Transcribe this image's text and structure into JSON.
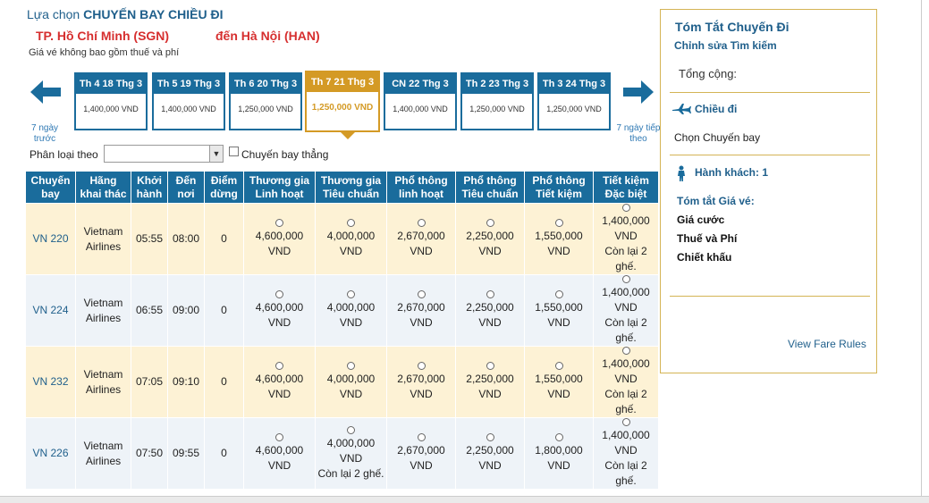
{
  "header": {
    "title_prefix": "Lựa chọn ",
    "title_bold": "CHUYẾN BAY CHIỀU ĐI",
    "from": "TP. Hồ Chí Minh (SGN)",
    "to": "đến Hà Nội (HAN)",
    "price_note": "Giá vé không bao gồm thuế và phí"
  },
  "nav": {
    "prev_text": "7 ngày trước",
    "next_text": "7 ngày tiếp theo"
  },
  "dates": [
    {
      "label": "Th 4 18 Thg 3",
      "price": "1,400,000 VND",
      "selected": false
    },
    {
      "label": "Th 5 19 Thg 3",
      "price": "1,400,000 VND",
      "selected": false
    },
    {
      "label": "Th 6 20 Thg 3",
      "price": "1,250,000 VND",
      "selected": false
    },
    {
      "label": "Th 7 21 Thg 3",
      "price": "1,250,000 VND",
      "selected": true
    },
    {
      "label": "CN 22 Thg 3",
      "price": "1,400,000 VND",
      "selected": false
    },
    {
      "label": "Th 2 23 Thg 3",
      "price": "1,250,000 VND",
      "selected": false
    },
    {
      "label": "Th 3 24 Thg 3",
      "price": "1,250,000 VND",
      "selected": false
    }
  ],
  "filter": {
    "label": "Phân loại theo",
    "selected": "",
    "direct_label": "Chuyến bay thẳng"
  },
  "table": {
    "headers": [
      "Chuyến bay",
      "Hãng khai thác",
      "Khởi hành",
      "Đến nơi",
      "Điểm dừng",
      "Thương gia Linh hoạt",
      "Thương gia Tiêu chuẩn",
      "Phổ thông linh hoạt",
      "Phổ thông Tiêu chuẩn",
      "Phổ thông Tiết kiệm",
      "Tiết kiệm Đặc biệt"
    ],
    "rows": [
      {
        "flight": "VN 220",
        "airline": "Vietnam Airlines",
        "depart": "05:55",
        "arrive": "08:00",
        "stops": "0",
        "fares": [
          [
            "4,600,000",
            "VND",
            ""
          ],
          [
            "4,000,000",
            "VND",
            ""
          ],
          [
            "2,670,000",
            "VND",
            ""
          ],
          [
            "2,250,000",
            "VND",
            ""
          ],
          [
            "1,550,000",
            "VND",
            ""
          ],
          [
            "1,400,000",
            "VND",
            "Còn lại 2 ghế."
          ]
        ]
      },
      {
        "flight": "VN 224",
        "airline": "Vietnam Airlines",
        "depart": "06:55",
        "arrive": "09:00",
        "stops": "0",
        "fares": [
          [
            "4,600,000",
            "VND",
            ""
          ],
          [
            "4,000,000",
            "VND",
            ""
          ],
          [
            "2,670,000",
            "VND",
            ""
          ],
          [
            "2,250,000",
            "VND",
            ""
          ],
          [
            "1,550,000",
            "VND",
            ""
          ],
          [
            "1,400,000",
            "VND",
            "Còn lại 2 ghế."
          ]
        ]
      },
      {
        "flight": "VN 232",
        "airline": "Vietnam Airlines",
        "depart": "07:05",
        "arrive": "09:10",
        "stops": "0",
        "fares": [
          [
            "4,600,000",
            "VND",
            ""
          ],
          [
            "4,000,000",
            "VND",
            ""
          ],
          [
            "2,670,000",
            "VND",
            ""
          ],
          [
            "2,250,000",
            "VND",
            ""
          ],
          [
            "1,550,000",
            "VND",
            ""
          ],
          [
            "1,400,000",
            "VND",
            "Còn lại 2 ghế."
          ]
        ]
      },
      {
        "flight": "VN 226",
        "airline": "Vietnam Airlines",
        "depart": "07:50",
        "arrive": "09:55",
        "stops": "0",
        "fares": [
          [
            "4,600,000",
            "VND",
            ""
          ],
          [
            "4,000,000",
            "VND",
            "Còn lại 2 ghế."
          ],
          [
            "2,670,000",
            "VND",
            ""
          ],
          [
            "2,250,000",
            "VND",
            ""
          ],
          [
            "1,800,000",
            "VND",
            ""
          ],
          [
            "1,400,000",
            "VND",
            "Còn lại 2 ghế."
          ]
        ]
      }
    ]
  },
  "summary": {
    "title": "Tóm Tắt Chuyến Đi",
    "edit": "Chỉnh sửa Tìm kiếm",
    "total": "Tổng cộng:",
    "depart": "Chiều đi",
    "choose": "Chọn Chuyến bay",
    "passengers": "Hành khách: 1",
    "fare_summary": "Tóm tắt Giá vé:",
    "items": [
      "Giá cước",
      "Thuế và Phí",
      "Chiết khấu"
    ],
    "rules": "View Fare Rules"
  },
  "colors": {
    "primary": "#1a6c9c",
    "selected": "#d49a25",
    "route": "#d62f2f",
    "row_odd": "#fdf2d5",
    "row_even": "#eef3f8"
  }
}
